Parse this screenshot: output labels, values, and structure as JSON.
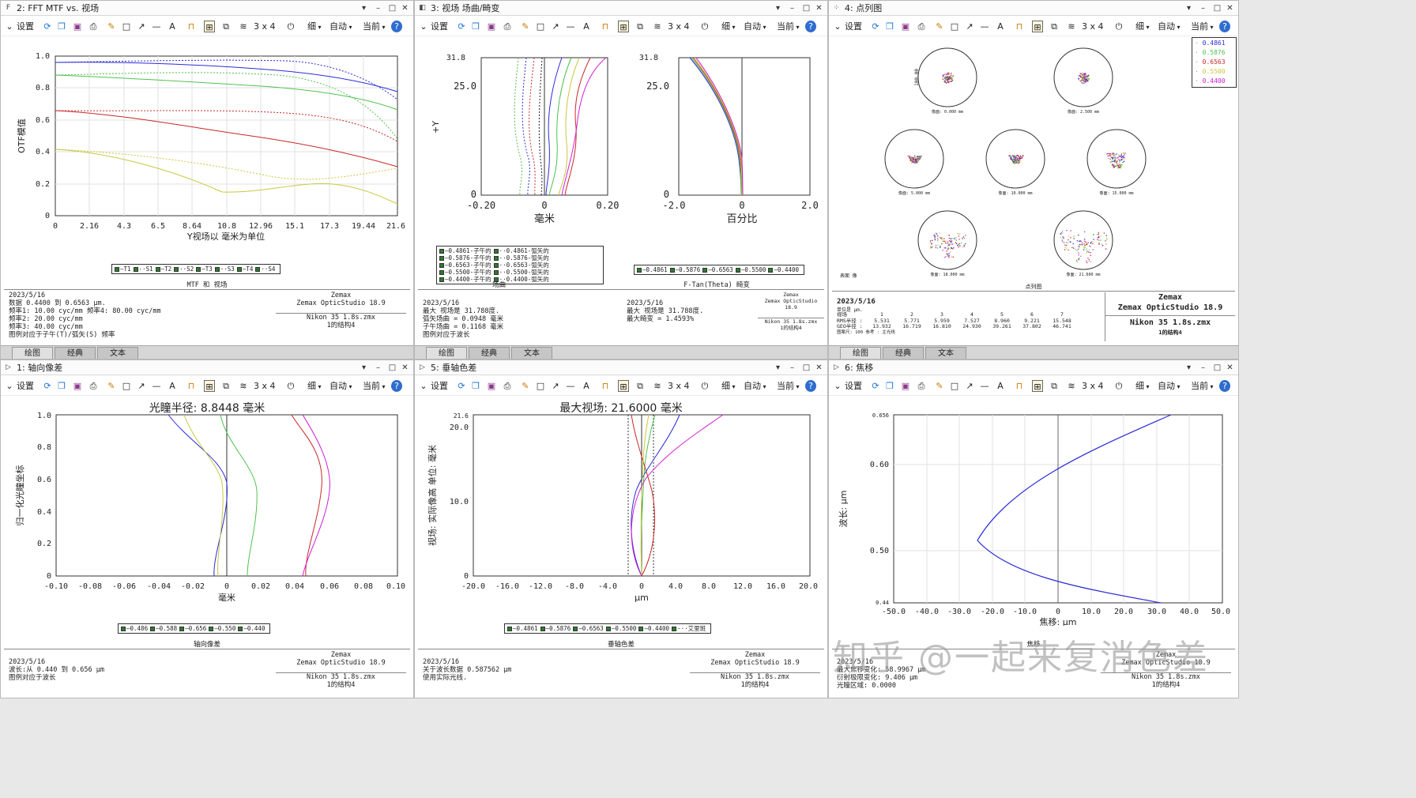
{
  "windows": [
    {
      "title": "2: FFT MTF vs. 视场",
      "plot_caption": "MTF 和 视场",
      "ylabel": "OTF模值",
      "xlabel": "Y视场以 毫米为单位",
      "xticks": [
        "0",
        "2.16",
        "4.3",
        "6.5",
        "8.64",
        "10.8",
        "12.96",
        "15.1",
        "17.3",
        "19.44",
        "21.6"
      ],
      "yticks": [
        "0",
        "0.2",
        "0.4",
        "0.6",
        "0.8",
        "1.0"
      ],
      "legend": [
        "—T1",
        "··S1",
        "—T2",
        "··S2",
        "—T3",
        "··S3",
        "—T4",
        "··S4"
      ],
      "info_left": [
        "2023/5/16",
        "数据 0.4400 到 0.6563 µm.",
        "频率1:   10.00 cyc/mm        频率4:   80.00 cyc/mm",
        "频率2:   20.00 cyc/mm",
        "频率3:   40.00 cyc/mm",
        "图例对应于子午(T)/弧矢(S) 频率"
      ],
      "info_right": [
        "Zemax",
        "Zemax OpticStudio 18.9",
        "",
        "Nikon 35 1.8s.zmx",
        "1的结构4"
      ]
    },
    {
      "title": "3: 视场 场曲/畸变",
      "plot_caption": "场曲                                            F-Tan(Theta) 畸变",
      "fc_xlabel": "毫米",
      "fc_ylabel": "+Y",
      "fc_xticks": [
        "-0.20",
        "0",
        "0.20"
      ],
      "fc_yticks": [
        "0",
        "25.0",
        "31.8"
      ],
      "dist_xlabel": "百分比",
      "dist_xticks": [
        "-2.0",
        "0",
        "2.0"
      ],
      "dist_yticks": [
        "0",
        "25.0",
        "31.8"
      ],
      "legend_fc": [
        "—0.4861-子午的",
        "··0.4861-弧矢的",
        "—0.5876-子午的",
        "··0.5876-弧矢的",
        "—0.6563-子午的",
        "··0.6563-弧矢的",
        "—0.5500-子午的",
        "··0.5500-弧矢的",
        "—0.4400-子午的",
        "··0.4400-弧矢的"
      ],
      "legend_dist": [
        "—0.4861",
        "—0.5876",
        "—0.6563",
        "—0.5500",
        "—0.4400"
      ],
      "info_left": [
        "2023/5/16",
        "最大 视场是 31.788度.",
        "弧矢场曲 = 0.0948 毫米",
        "子午场曲 = 0.1168 毫米",
        "图例对应于波长"
      ],
      "info_mid": [
        "2023/5/16",
        "最大 视场是 31.788度.",
        "最大畸变 = 1.4593%"
      ],
      "info_right": [
        "Zemax",
        "Zemax OpticStudio 18.9",
        "",
        "Nikon 35 1.8s.zmx",
        "1的结构4"
      ]
    },
    {
      "title": "4: 点列图",
      "plot_caption": "点列图",
      "legend": [
        "0.4861",
        "0.5876",
        "0.6563",
        "0.5500",
        "0.4400"
      ],
      "spot_labels": [
        "像面: 0.000 mm",
        "像面: 2.500 mm",
        "像面: 5.000 mm",
        "像面: 10.000 mm",
        "像面: 15.000 mm",
        "像面: 18.000 mm",
        "像面: 21.600 mm"
      ],
      "scale_label": "100.00",
      "surface_label": "表面 像",
      "info_date": "2023/5/16",
      "info_unit": "单位是 µm.",
      "table": {
        "fields_label": "视场",
        "fields": [
          "1",
          "2",
          "3",
          "4",
          "5",
          "6",
          "7"
        ],
        "rms_label": "RMS半径 :",
        "rms": [
          "5.531",
          "5.771",
          "5.959",
          "7.527",
          "8.960",
          "9.221",
          "15.548"
        ],
        "geo_label": "GEO半径 :",
        "geo": [
          "13.932",
          "16.719",
          "16.810",
          "24.930",
          "39.261",
          "37.802",
          "46.741"
        ],
        "scale_row": "图案尺:     100     参考 : 主光线"
      },
      "info_right": [
        "Zemax",
        "Zemax OpticStudio 18.9",
        "",
        "Nikon 35 1.8s.zmx",
        "1的结构4"
      ]
    },
    {
      "title": "1: 轴向像差",
      "plot_caption": "轴向像差",
      "big_title": "光瞳半径: 8.8448 毫米",
      "ylabel": "归一化光瞳坐标",
      "xlabel": "毫米",
      "xticks": [
        "-0.10",
        "-0.08",
        "-0.06",
        "-0.04",
        "-0.02",
        "0",
        "0.02",
        "0.04",
        "0.06",
        "0.08",
        "0.10"
      ],
      "yticks": [
        "0",
        "0.2",
        "0.4",
        "0.6",
        "0.8",
        "1.0"
      ],
      "legend": [
        "—0.486",
        "—0.588",
        "—0.656",
        "—0.550",
        "—0.440"
      ],
      "info_left": [
        "2023/5/16",
        "波长:从 0.440 到 0.656 µm",
        "图例对应于波长"
      ],
      "info_right": [
        "Zemax",
        "Zemax OpticStudio 18.9",
        "",
        "Nikon 35 1.8s.zmx",
        "1的结构4"
      ]
    },
    {
      "title": "5: 垂轴色差",
      "plot_caption": "垂轴色差",
      "big_title": "最大视场: 21.6000 毫米",
      "ylabel": "视场: 实际像高 单位: 毫米",
      "xlabel": "µm",
      "xticks": [
        "-20.0",
        "-16.0",
        "-12.0",
        "-8.0",
        "-4.0",
        "0",
        "4.0",
        "8.0",
        "12.0",
        "16.0",
        "20.0"
      ],
      "yticks": [
        "0",
        "10.0",
        "20.0",
        "21.6"
      ],
      "legend": [
        "—0.4861",
        "—0.5876",
        "—0.6563",
        "—0.5500",
        "—0.4400",
        "···艾里斑"
      ],
      "info_left": [
        "2023/5/16",
        "关于波长数据 0.587562 µm",
        "使用实际光线."
      ],
      "info_right": [
        "Zemax",
        "Zemax OpticStudio 18.9",
        "",
        "Nikon 35 1.8s.zmx",
        "1的结构4"
      ]
    },
    {
      "title": "6: 焦移",
      "plot_caption": "焦移",
      "ylabel": "波长: µm",
      "xlabel": "焦移: µm",
      "xticks": [
        "-50.0",
        "-40.0",
        "-30.0",
        "-20.0",
        "-10.0",
        "0",
        "10.0",
        "20.0",
        "30.0",
        "40.0",
        "50.0"
      ],
      "yticks": [
        "0.44",
        "0.50",
        "0.60",
        "0.656"
      ],
      "info_left": [
        "2023/5/16",
        "最大焦移变化: 58.9967 µm",
        "衍射极限变化: 9.406 µm",
        "光瞳区域: 0.0000"
      ],
      "info_right": [
        "Zemax",
        "Zemax OpticStudio 18.9",
        "",
        "Nikon 35 1.8s.zmx",
        "1的结构4"
      ]
    }
  ],
  "toolbar": {
    "settings_label": "设置",
    "layout_label": "3 x 4",
    "thin_label": "细",
    "auto_label": "自动",
    "current_label": "当前"
  },
  "tabs": [
    "绘图",
    "经典",
    "文本"
  ],
  "watermark": "知乎 @一起来复消色差",
  "colors": {
    "blue": "#2b2bd9",
    "green": "#4fc24f",
    "red": "#c82828",
    "yellow": "#c8c840",
    "magenta": "#d21ed2",
    "dark": "#222222"
  }
}
